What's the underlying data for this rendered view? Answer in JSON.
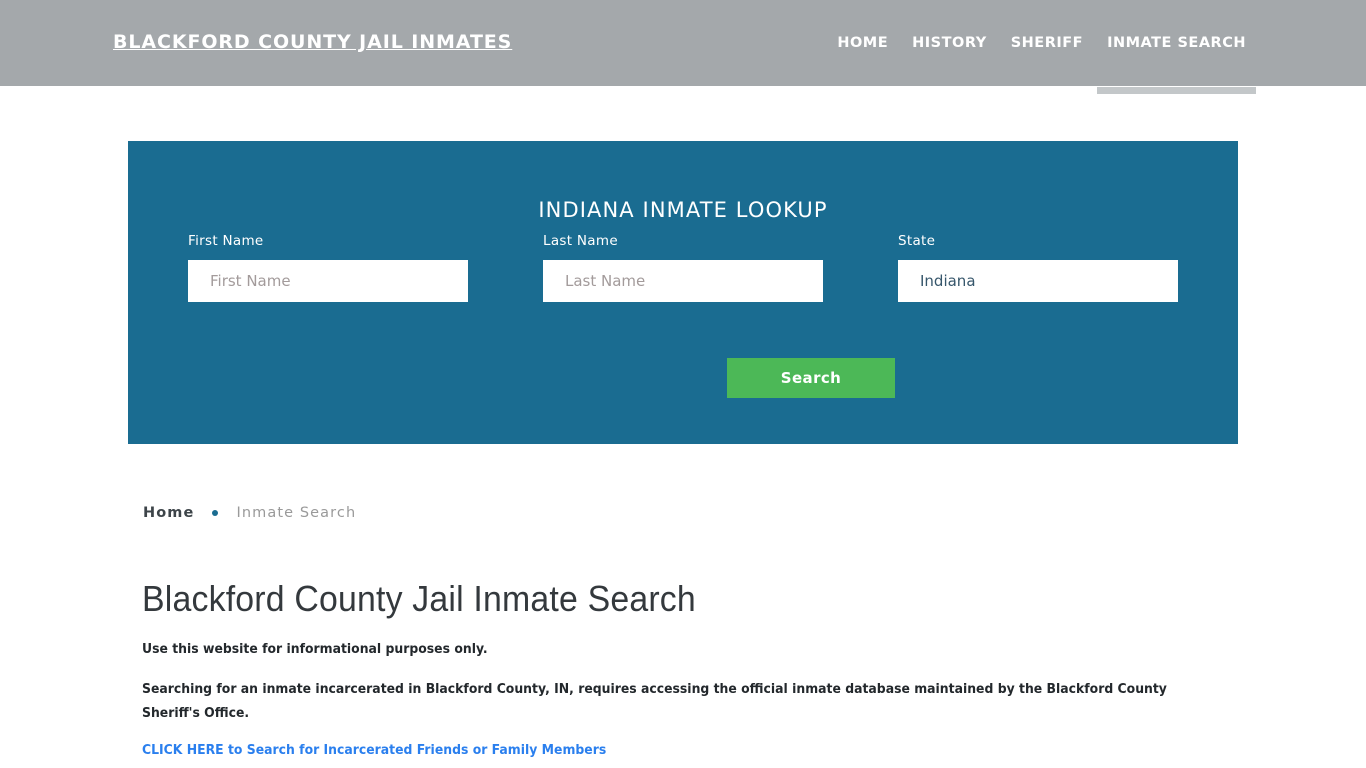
{
  "header": {
    "brand": "BLACKFORD COUNTY JAIL INMATES",
    "background_color": "#a4a8ab",
    "nav": [
      {
        "label": "HOME",
        "active": false
      },
      {
        "label": "HISTORY",
        "active": false
      },
      {
        "label": "SHERIFF",
        "active": false
      },
      {
        "label": "INMATE SEARCH",
        "active": true
      }
    ]
  },
  "lookup_panel": {
    "title": "INDIANA INMATE LOOKUP",
    "background_color": "#1a6c91",
    "fields": [
      {
        "label": "First Name",
        "placeholder": "First Name",
        "value": ""
      },
      {
        "label": "Last Name",
        "placeholder": "Last Name",
        "value": ""
      },
      {
        "label": "State",
        "placeholder": "State",
        "value": "Indiana"
      }
    ],
    "submit": {
      "label": "Search",
      "color": "#4cb857"
    }
  },
  "breadcrumb": {
    "home": "Home",
    "separator": "•",
    "current": "Inmate Search"
  },
  "main": {
    "page_title": "Blackford County Jail Inmate Search",
    "paragraph_1": "Use this website for informational purposes only.",
    "paragraph_2": "Searching for an inmate incarcerated in Blackford County, IN, requires accessing the official inmate database maintained by the Blackford County Sheriff's Office.",
    "cta_link": "CLICK HERE to Search for Incarcerated Friends or Family Members",
    "link_color": "#2a7fee"
  }
}
